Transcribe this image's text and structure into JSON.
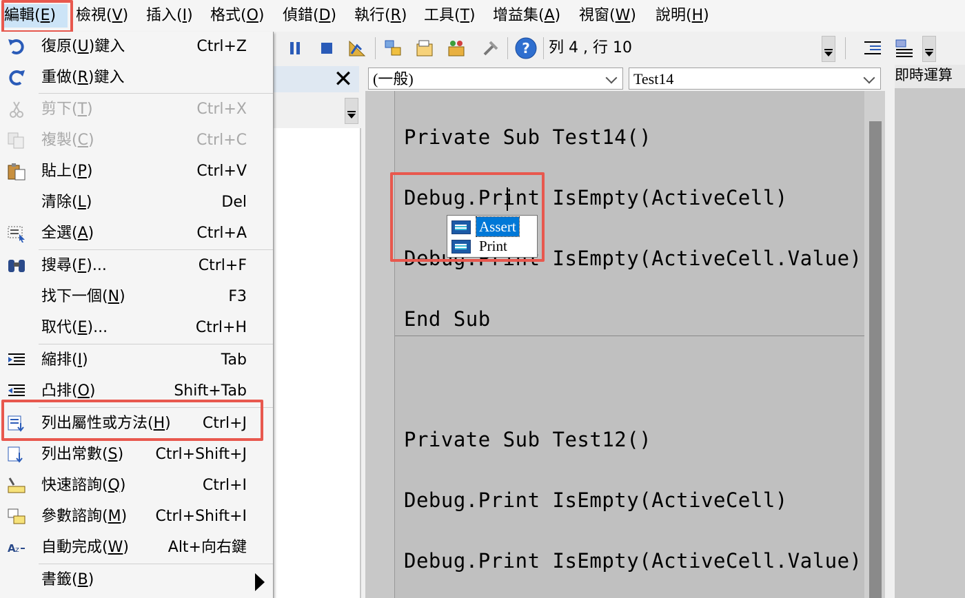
{
  "menubar": {
    "items": [
      {
        "label": "編輯(",
        "key": "E",
        "tail": ")",
        "open": true
      },
      {
        "label": "檢視(",
        "key": "V",
        "tail": ")"
      },
      {
        "label": "插入(",
        "key": "I",
        "tail": ")"
      },
      {
        "label": "格式(",
        "key": "O",
        "tail": ")"
      },
      {
        "label": "偵錯(",
        "key": "D",
        "tail": ")"
      },
      {
        "label": "執行(",
        "key": "R",
        "tail": ")"
      },
      {
        "label": "工具(",
        "key": "T",
        "tail": ")"
      },
      {
        "label": "增益集(",
        "key": "A",
        "tail": ")"
      },
      {
        "label": "視窗(",
        "key": "W",
        "tail": ")"
      },
      {
        "label": "說明(",
        "key": "H",
        "tail": ")"
      }
    ]
  },
  "toolbar": {
    "status": "列 4 , 行 10",
    "icons": [
      "pause-icon",
      "stop-icon",
      "design-mode-icon",
      "project-explorer-icon",
      "properties-icon",
      "object-browser-icon",
      "toolbox-icon",
      "help-icon",
      "indent-icon",
      "outdent-icon"
    ]
  },
  "code_window": {
    "object_combo": "(一般)",
    "procedure_combo": "Test14",
    "lines": [
      "Private Sub Test14()",
      "Debug.Print IsEmpty(ActiveCell)",
      "Debug.Print IsEmpty(ActiveCell.Value)",
      "End Sub",
      "Private Sub Test12()",
      "Debug.Print IsEmpty(ActiveCell)",
      "Debug.Print IsEmpty(ActiveCell.Value)"
    ],
    "autocomplete": [
      "Assert",
      "Print"
    ],
    "autocomplete_selected": "Assert"
  },
  "immediate_window": {
    "title": "即時運算"
  },
  "edit_menu": {
    "items": [
      {
        "label": "復原(",
        "key": "U",
        "tail": ")鍵入",
        "shortcut": "Ctrl+Z",
        "icon": "undo-icon"
      },
      {
        "label": "重做(",
        "key": "R",
        "tail": ")鍵入",
        "shortcut": "",
        "icon": "redo-icon"
      },
      {
        "label": "剪下(",
        "key": "T",
        "tail": ")",
        "shortcut": "Ctrl+X",
        "icon": "cut-icon",
        "disabled": true
      },
      {
        "label": "複製(",
        "key": "C",
        "tail": ")",
        "shortcut": "Ctrl+C",
        "icon": "copy-icon",
        "disabled": true
      },
      {
        "label": "貼上(",
        "key": "P",
        "tail": ")",
        "shortcut": "Ctrl+V",
        "icon": "paste-icon"
      },
      {
        "label": "清除(",
        "key": "L",
        "tail": ")",
        "shortcut": "Del",
        "icon": ""
      },
      {
        "label": "全選(",
        "key": "A",
        "tail": ")",
        "shortcut": "Ctrl+A",
        "icon": "select-all-icon"
      },
      {
        "label": "搜尋(",
        "key": "F",
        "tail": ")...",
        "shortcut": "Ctrl+F",
        "icon": "binoculars-icon"
      },
      {
        "label": "找下一個(",
        "key": "N",
        "tail": ")",
        "shortcut": "F3",
        "icon": ""
      },
      {
        "label": "取代(",
        "key": "E",
        "tail": ")...",
        "shortcut": "Ctrl+H",
        "icon": ""
      },
      {
        "label": "縮排(",
        "key": "I",
        "tail": ")",
        "shortcut": "Tab",
        "icon": "indent-icon"
      },
      {
        "label": "凸排(",
        "key": "O",
        "tail": ")",
        "shortcut": "Shift+Tab",
        "icon": "outdent-icon"
      },
      {
        "label": "列出屬性或方法(",
        "key": "H",
        "tail": ")",
        "shortcut": "Ctrl+J",
        "icon": "list-members-icon",
        "highlighted": true
      },
      {
        "label": "列出常數(",
        "key": "S",
        "tail": ")",
        "shortcut": "Ctrl+Shift+J",
        "icon": "list-constants-icon"
      },
      {
        "label": "快速諮詢(",
        "key": "Q",
        "tail": ")",
        "shortcut": "Ctrl+I",
        "icon": "quick-info-icon"
      },
      {
        "label": "參數諮詢(",
        "key": "M",
        "tail": ")",
        "shortcut": "Ctrl+Shift+I",
        "icon": "parameter-info-icon"
      },
      {
        "label": "自動完成(",
        "key": "W",
        "tail": ")",
        "shortcut": "Alt+向右鍵",
        "icon": "complete-word-icon"
      },
      {
        "label": "書籤(",
        "key": "B",
        "tail": ")",
        "shortcut": "",
        "icon": "",
        "submenu": true
      }
    ]
  },
  "colors": {
    "highlight_box": "#e8584e",
    "selection": "#0078d7",
    "code_bg": "#c0c0c0"
  }
}
